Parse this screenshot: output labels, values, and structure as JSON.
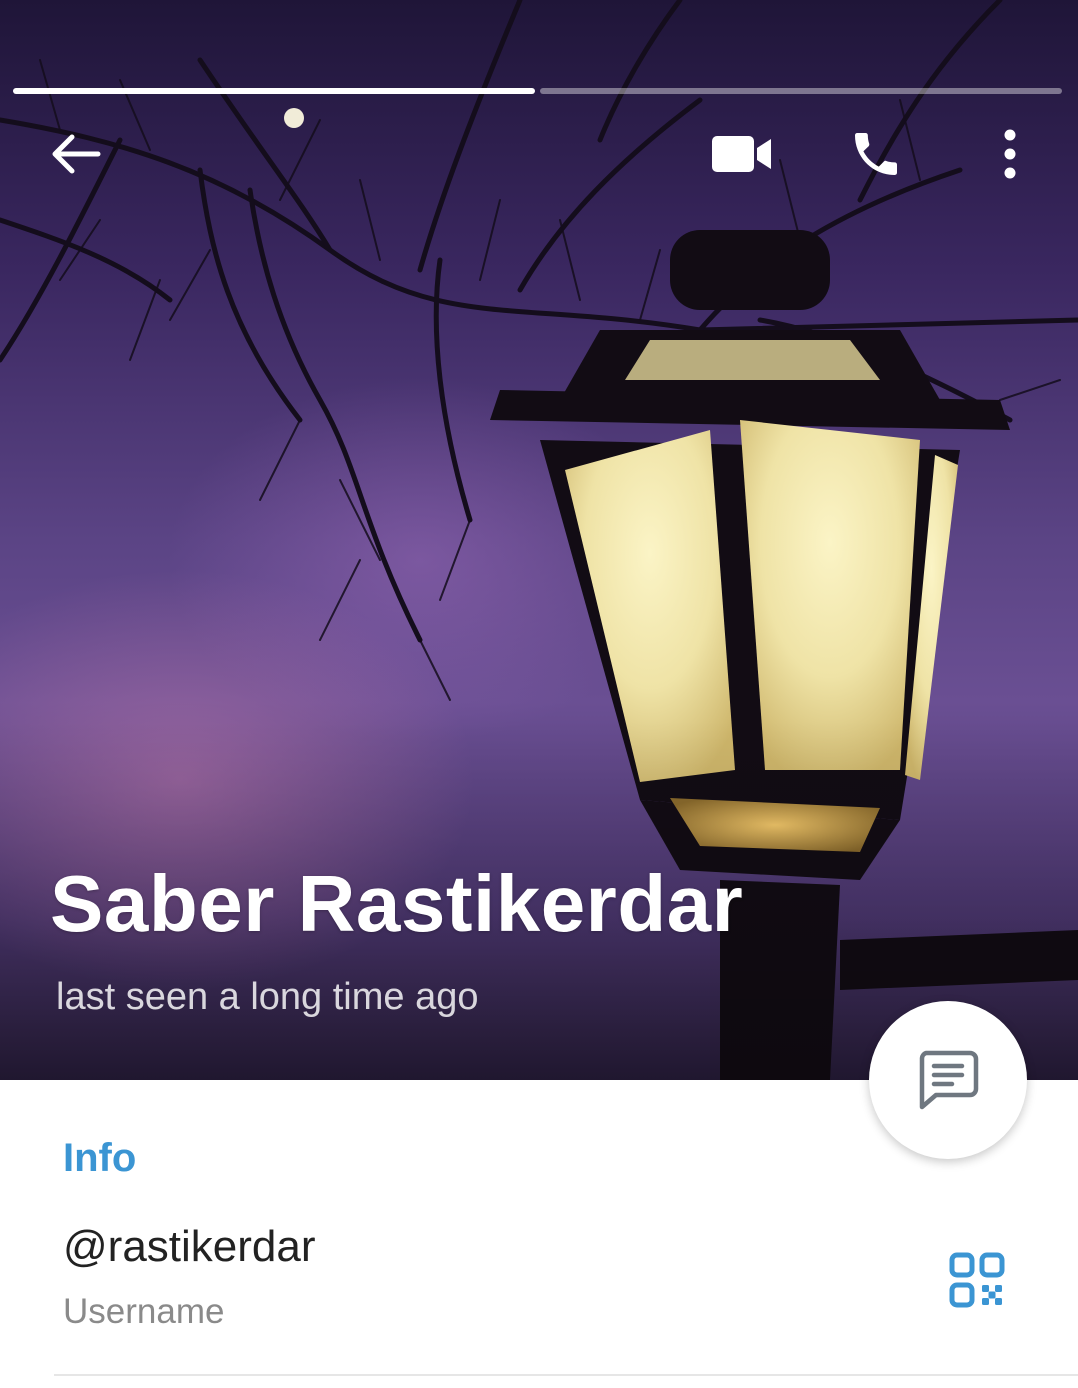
{
  "profile": {
    "name": "Saber Rastikerdar",
    "status": "last seen a long time ago"
  },
  "story_progress": {
    "segments": 2,
    "current": 1
  },
  "header_icons": {
    "back": "arrow-left-icon",
    "video": "video-camera-icon",
    "call": "phone-icon",
    "more": "more-vertical-icon"
  },
  "info": {
    "section_title": "Info",
    "username_value": "@rastikerdar",
    "username_label": "Username",
    "qr_icon": "qr-code-icon"
  },
  "fab_icon": "message-icon",
  "colors": {
    "accent": "#3b95d3",
    "text_primary": "#222222",
    "text_secondary": "#8a8a8a"
  }
}
